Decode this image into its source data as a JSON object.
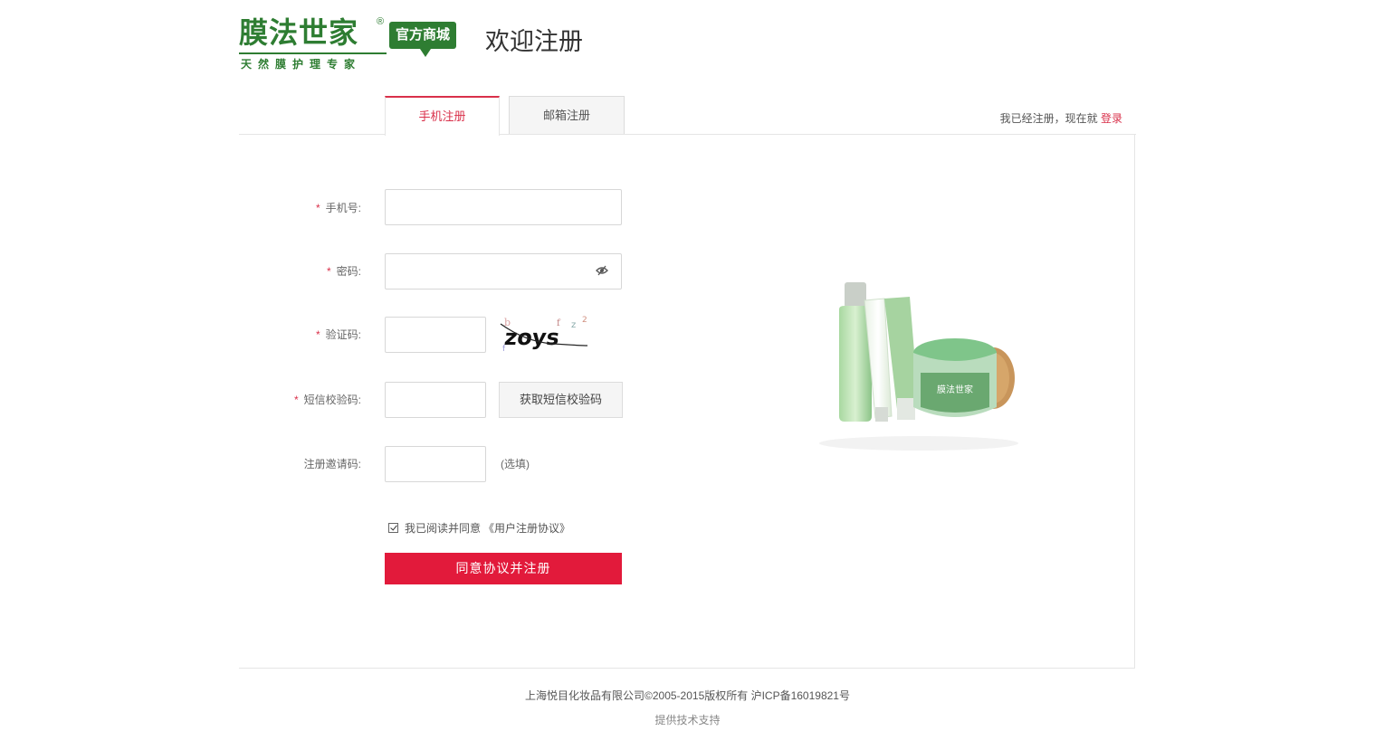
{
  "header": {
    "brand": "膜法世家",
    "reg_mark": "®",
    "badge": "官方商城",
    "slogan": "天然膜护理专家",
    "page_title": "欢迎注册"
  },
  "tabs": [
    {
      "label": "手机注册",
      "active": true
    },
    {
      "label": "邮箱注册",
      "active": false
    }
  ],
  "login_hint": {
    "text": "我已经注册，现在就",
    "link": "登录"
  },
  "form": {
    "required_mark": "*",
    "phone_label": "手机号:",
    "password_label": "密码:",
    "captcha_label": "验证码:",
    "captcha_text": "zoys",
    "sms_label": "短信校验码:",
    "sms_button": "获取短信校验码",
    "invite_label": "注册邀请码:",
    "invite_optional": "(选填)",
    "agree_text": "我已阅读并同意",
    "agree_link": "《用户注册协议》",
    "agree_checked": true,
    "submit": "同意协议并注册"
  },
  "footer": {
    "copyright": "上海悦目化妆品有限公司©2005-2015版权所有 沪ICP备16019821号",
    "support": "提供技术支持"
  },
  "colors": {
    "accent": "#e21a3b",
    "brand_green": "#2e7d32",
    "tab_active": "#d9304a"
  }
}
